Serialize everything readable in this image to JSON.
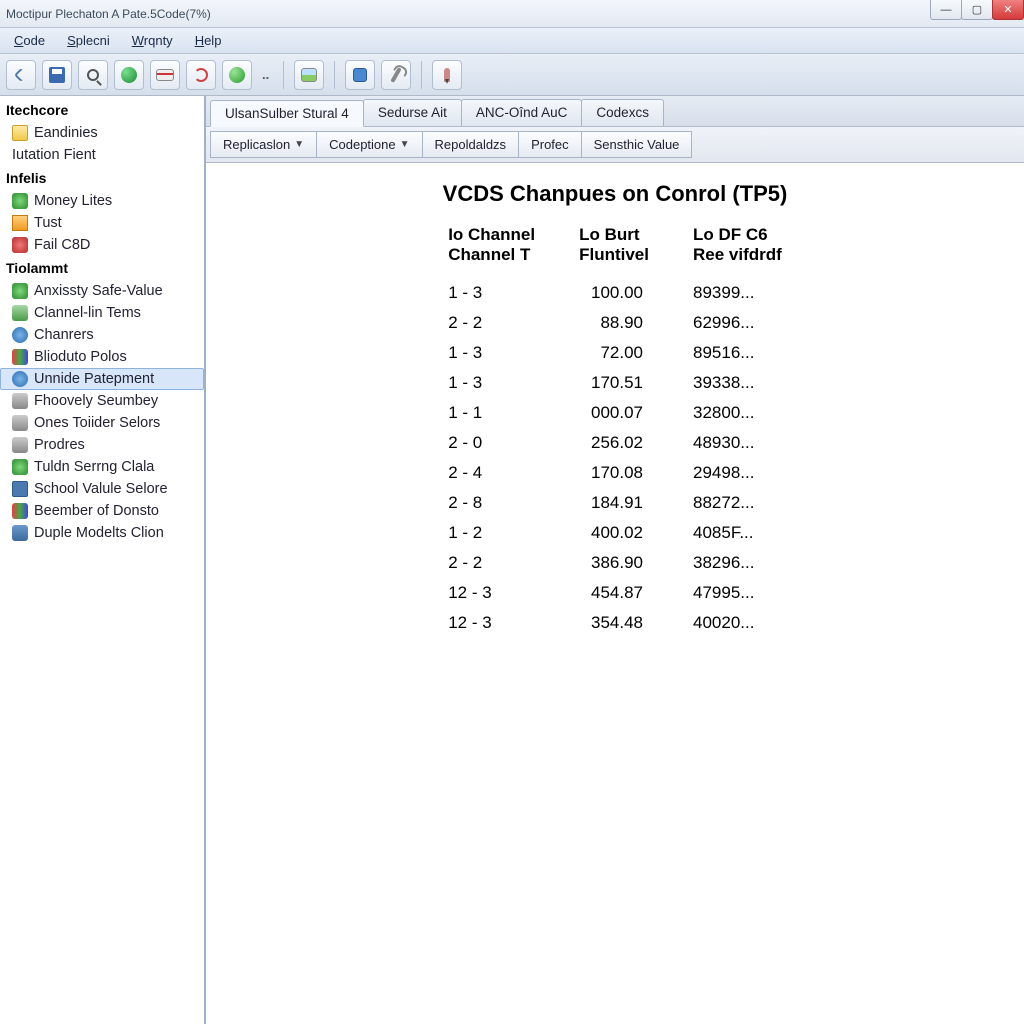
{
  "window": {
    "title": "Moctipur Plechaton A Pate.5Code(7%)"
  },
  "menubar": [
    "Code",
    "Splecni",
    "Wrqnty",
    "Help"
  ],
  "sidebar": {
    "groups": [
      {
        "header": "Itechcore",
        "items": [
          {
            "label": "Eandinies",
            "icon": "tico-folder"
          },
          {
            "label": "Iutation Fient",
            "icon": "",
            "plain": true
          }
        ]
      },
      {
        "header": "Infelis",
        "items": [
          {
            "label": "Money Lites",
            "icon": "tico-green"
          },
          {
            "label": "Tust",
            "icon": "tico-orange"
          },
          {
            "label": "Fail C8D",
            "icon": "tico-red"
          }
        ]
      },
      {
        "header": "Tiolammt",
        "items": [
          {
            "label": "Anxissty Safe-Value",
            "icon": "tico-green"
          },
          {
            "label": "Clannel-lin Tems",
            "icon": "tico-people"
          },
          {
            "label": "Chanrers",
            "icon": "tico-blue"
          },
          {
            "label": "Blioduto Polos",
            "icon": "tico-multi"
          },
          {
            "label": "Unnide Patepment",
            "icon": "tico-blue",
            "selected": true
          },
          {
            "label": "Fhoovely Seumbey",
            "icon": "tico-gray"
          },
          {
            "label": "Ones Toiider Selors",
            "icon": "tico-gray"
          },
          {
            "label": "Prodres",
            "icon": "tico-gray"
          },
          {
            "label": "Tuldn Serrng Clala",
            "icon": "tico-green"
          },
          {
            "label": "School Valule Selore",
            "icon": "tico-monitor"
          },
          {
            "label": "Beember of Donsto",
            "icon": "tico-multi"
          },
          {
            "label": "Duple Modelts Clion",
            "icon": "tico-net"
          }
        ]
      }
    ]
  },
  "tabs1": [
    {
      "label": "UlsanSulber Stural 4",
      "active": true
    },
    {
      "label": "Sedurse Ait"
    },
    {
      "label": "ANC-Oînd AuC"
    },
    {
      "label": "Codexcs"
    }
  ],
  "tabs2": [
    {
      "label": "Replicaslon",
      "dropdown": true
    },
    {
      "label": "Codeptione",
      "dropdown": true
    },
    {
      "label": "Repoldaldzs"
    },
    {
      "label": "Profec"
    },
    {
      "label": "Sensthic Value"
    }
  ],
  "content": {
    "heading": "VCDS Chanpues on Conrol (TP5)",
    "columns": [
      {
        "line1": "Io Channel",
        "line2": "Channel T"
      },
      {
        "line1": "Lo Burt",
        "line2": "Fluntivel"
      },
      {
        "line1": "Lo DF C6",
        "line2": "Ree vifdrdf"
      }
    ],
    "rows": [
      {
        "c1": "1 - 3",
        "c2": "100.00",
        "c3": "89399..."
      },
      {
        "c1": "2 - 2",
        "c2": "88.90",
        "c3": "62996..."
      },
      {
        "c1": "1 - 3",
        "c2": "72.00",
        "c3": "89516..."
      },
      {
        "c1": "1 - 3",
        "c2": "170.51",
        "c3": "39338..."
      },
      {
        "c1": "1 - 1",
        "c2": "000.07",
        "c3": "32800..."
      },
      {
        "c1": "2 - 0",
        "c2": "256.02",
        "c3": "48930..."
      },
      {
        "c1": "2 - 4",
        "c2": "170.08",
        "c3": "29498..."
      },
      {
        "c1": "2 - 8",
        "c2": "184.91",
        "c3": "88272..."
      },
      {
        "c1": "1 - 2",
        "c2": "400.02",
        "c3": "4085F..."
      },
      {
        "c1": "2 - 2",
        "c2": "386.90",
        "c3": "38296..."
      },
      {
        "c1": "12 - 3",
        "c2": "454.87",
        "c3": "47995..."
      },
      {
        "c1": "12 - 3",
        "c2": "354.48",
        "c3": "40020..."
      }
    ]
  }
}
